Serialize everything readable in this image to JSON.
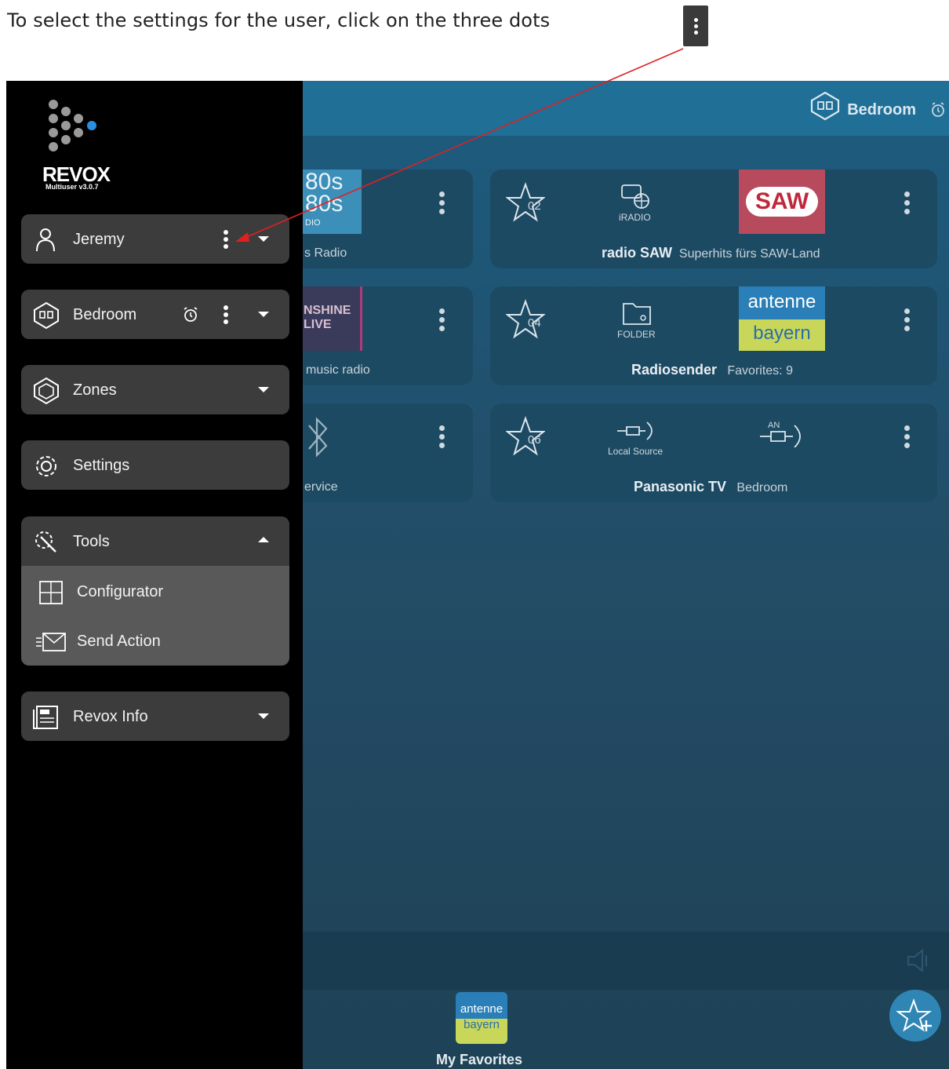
{
  "instruction": "To select the settings for the user, click on the three dots",
  "header": {
    "room": "Bedroom"
  },
  "cards": [
    {
      "big": "80s\n80s",
      "sub": "DIO",
      "caption": "s Radio"
    },
    {
      "num": "02",
      "source": "iRADIO",
      "logo": "SAW",
      "title": "radio SAW",
      "desc": "Superhits fürs SAW-Land"
    },
    {
      "big": "NSHINE\nLIVE",
      "caption": "music radio"
    },
    {
      "num": "04",
      "source": "FOLDER",
      "logo_top": "antenne",
      "logo_bottom": "bayern",
      "title": "Radiosender",
      "desc": "Favorites: 9"
    },
    {
      "caption": "ervice"
    },
    {
      "num": "06",
      "source": "Local Source",
      "title": "Panasonic TV",
      "desc": "Bedroom",
      "an": "AN"
    }
  ],
  "bottom": {
    "fav_label": "My Favorites",
    "fav_logo_top": "antenne",
    "fav_logo_bottom": "bayern"
  },
  "drawer": {
    "brand": "REVOX",
    "version": "Multiuser v3.0.7",
    "items": [
      {
        "label": "Jeremy",
        "icon": "user-icon"
      },
      {
        "label": "Bedroom",
        "icon": "room-icon"
      },
      {
        "label": "Zones",
        "icon": "zones-icon"
      },
      {
        "label": "Settings",
        "icon": "gear-icon"
      },
      {
        "label": "Tools",
        "icon": "tools-icon"
      },
      {
        "label": "Revox Info",
        "icon": "info-icon"
      }
    ],
    "tools_sub": [
      {
        "label": "Configurator",
        "icon": "configurator-icon"
      },
      {
        "label": "Send Action",
        "icon": "send-action-icon"
      }
    ]
  },
  "colors": {
    "accent": "#2f86b5",
    "arrow": "#e02020",
    "drawer": "#000000"
  }
}
